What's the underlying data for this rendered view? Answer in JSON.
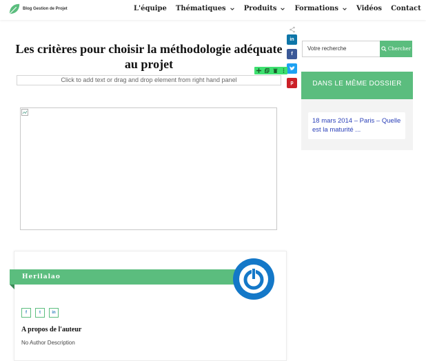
{
  "header": {
    "brand": "Blog Gestion de Projet",
    "nav": [
      {
        "label": "L'équipe",
        "dropdown": false
      },
      {
        "label": "Thématiques",
        "dropdown": true
      },
      {
        "label": "Produits",
        "dropdown": true
      },
      {
        "label": "Formations",
        "dropdown": true
      },
      {
        "label": "Vidéos",
        "dropdown": false
      },
      {
        "label": "Contact",
        "dropdown": false
      }
    ]
  },
  "article": {
    "title": "Les critères pour choisir la méthodologie adéquate au projet",
    "placeholder_text": "Click to add text or drag and drop element from right hand panel"
  },
  "share": {
    "linkedin": "in",
    "facebook": "f",
    "twitter": "t",
    "pinterest": "p"
  },
  "author": {
    "name": "Herilalao",
    "about_title": "A propos de l'auteur",
    "description": "No Author Description",
    "social": {
      "facebook": "f",
      "twitter": "t",
      "linkedin": "in"
    }
  },
  "sidebar": {
    "search_placeholder": "Votre recherche",
    "search_button": "Chercher",
    "widget_title": "DANS LE MÊME DOSSIER",
    "widget_item": "18 mars 2014 – Paris – Quelle est la maturité ..."
  },
  "colors": {
    "accent_green": "#5bbd7e",
    "toolbar_green": "#3ee070",
    "link_blue": "#2a3fb8"
  }
}
